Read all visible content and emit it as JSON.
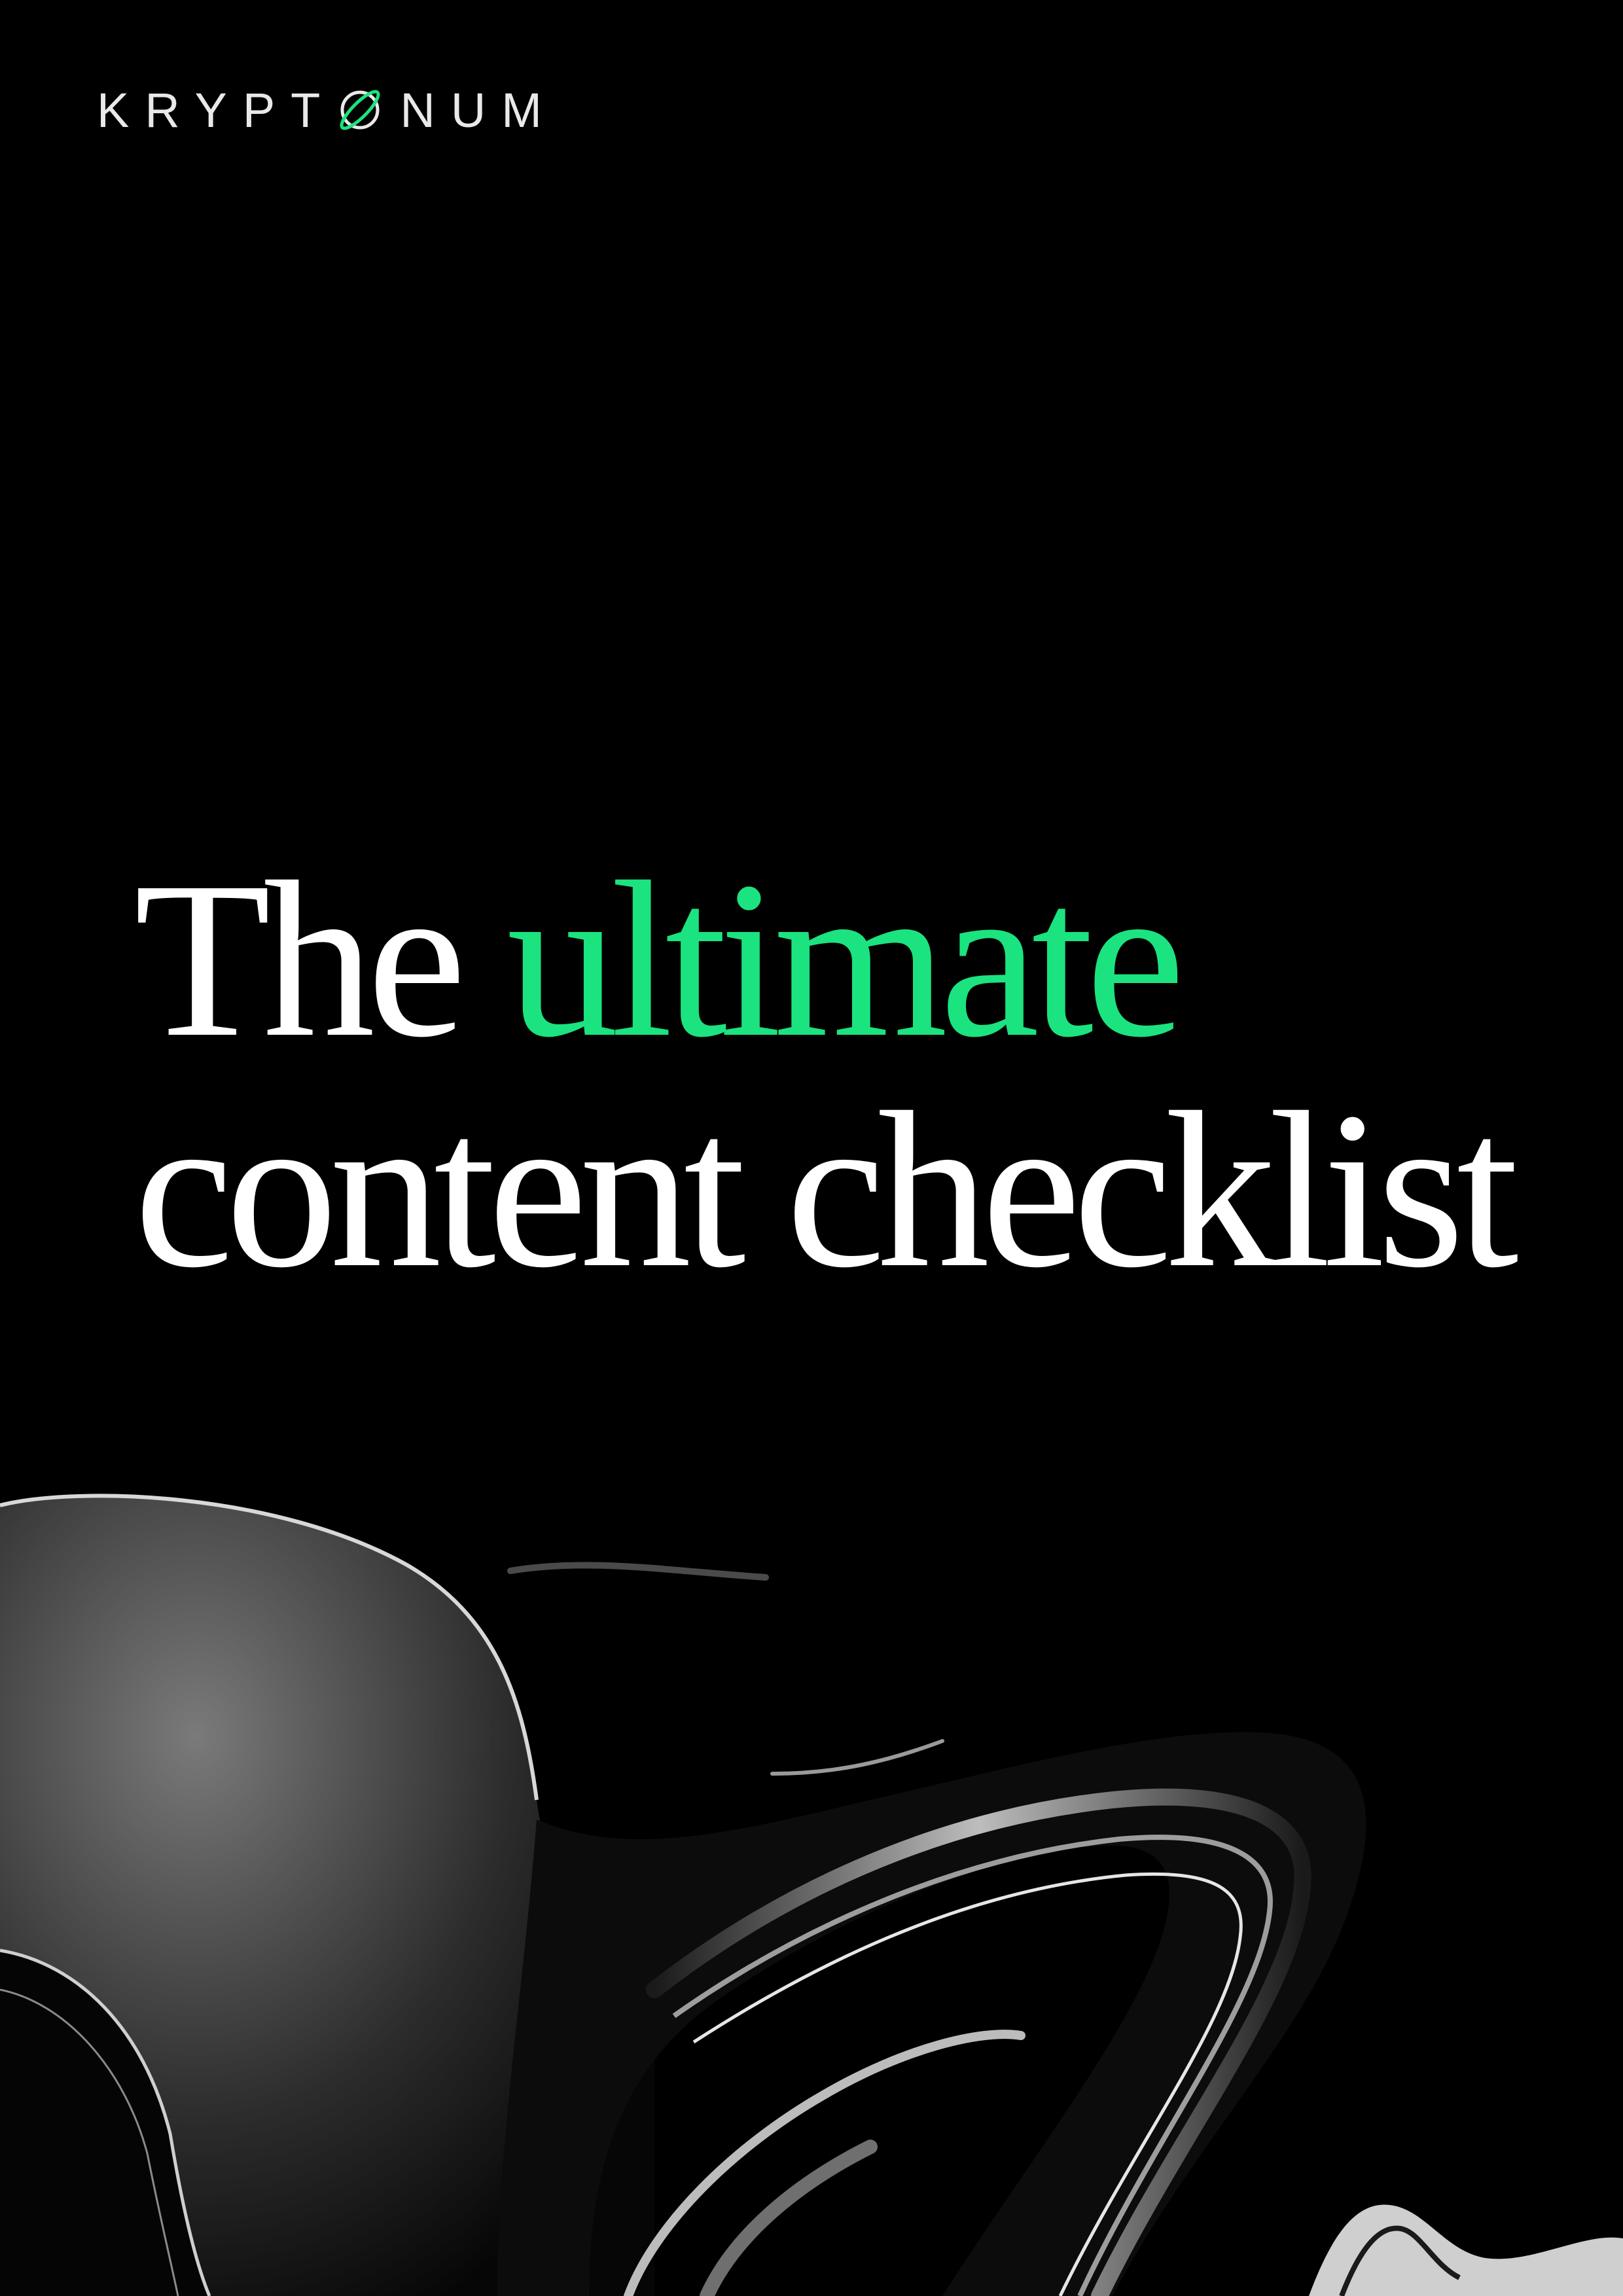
{
  "brand": {
    "logo_before": "KRYPT",
    "logo_after": "NUM",
    "logo_icon": "planet-o-icon",
    "accent_color": "#1be37f"
  },
  "headline": {
    "line1_prefix": "The",
    "line1_accent": "ultimate",
    "line2": "content checklist"
  },
  "colors": {
    "background": "#000000",
    "text": "#ffffff",
    "accent": "#1be37f"
  },
  "decoration": {
    "icon": "liquid-chrome-swirl-art"
  }
}
